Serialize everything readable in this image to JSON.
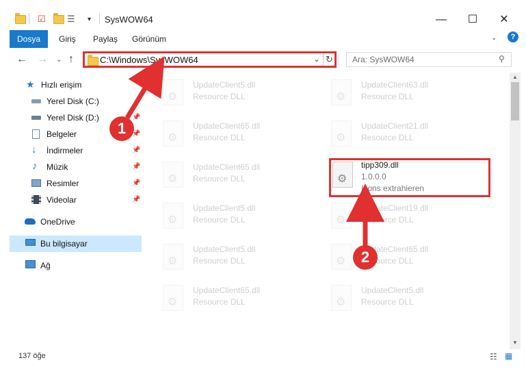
{
  "window": {
    "title": "SysWOW64",
    "minimize": "—",
    "maximize": "☐",
    "close": "✕",
    "help": "?"
  },
  "ribbon": {
    "tabs": [
      "Dosya",
      "Giriş",
      "Paylaş",
      "Görünüm"
    ]
  },
  "address": {
    "path": "C:\\Windows\\SysWOW64"
  },
  "search": {
    "placeholder": "Ara: SysWOW64"
  },
  "nav": {
    "items": [
      {
        "label": "Hızlı erişim",
        "icon": "star-icon",
        "pinned": false
      },
      {
        "label": "Yerel Disk (C:)",
        "icon": "drive-icon",
        "pinned": false
      },
      {
        "label": "Yerel Disk (D:)",
        "icon": "drive-icon",
        "pinned": true
      },
      {
        "label": "Belgeler",
        "icon": "documents-icon",
        "pinned": true
      },
      {
        "label": "İndirmeler",
        "icon": "downloads-icon",
        "pinned": true
      },
      {
        "label": "Müzik",
        "icon": "music-icon",
        "pinned": true
      },
      {
        "label": "Resimler",
        "icon": "pictures-icon",
        "pinned": true
      },
      {
        "label": "Videolar",
        "icon": "videos-icon",
        "pinned": true
      },
      {
        "label": "OneDrive",
        "icon": "cloud-icon",
        "pinned": false
      },
      {
        "label": "Bu bilgisayar",
        "icon": "computer-icon",
        "pinned": false
      },
      {
        "label": "Ağ",
        "icon": "network-icon",
        "pinned": false
      }
    ]
  },
  "files": [
    {
      "name": "UpdateClient5.dll",
      "desc": "Resource DLL"
    },
    {
      "name": "UpdateClient63.dll",
      "desc": "Resource DLL"
    },
    {
      "name": "UpdateClient65.dll",
      "desc": "Resource DLL"
    },
    {
      "name": "UpdateClient21.dll",
      "desc": "Resource DLL"
    },
    {
      "name": "UpdateClient65.dll",
      "desc": "Resource DLL"
    },
    {
      "name": "tipp309.dll",
      "desc": "1.0.0.0",
      "desc2": "Icons extrahieren"
    },
    {
      "name": "UpdateClient5.dll",
      "desc": "Resource DLL"
    },
    {
      "name": "UpdateClient19.dll",
      "desc": "Resource DLL"
    },
    {
      "name": "UpdateClient5.dll",
      "desc": "Resource DLL"
    },
    {
      "name": "UpdateClient65.dll",
      "desc": "Resource DLL"
    },
    {
      "name": "UpdateClient65.dll",
      "desc": "Resource DLL"
    },
    {
      "name": "UpdateClient5.dll",
      "desc": "Resource DLL"
    }
  ],
  "status": {
    "count": "137 öğe"
  },
  "annotations": {
    "step1": "1",
    "step2": "2",
    "color": "#e03030"
  }
}
